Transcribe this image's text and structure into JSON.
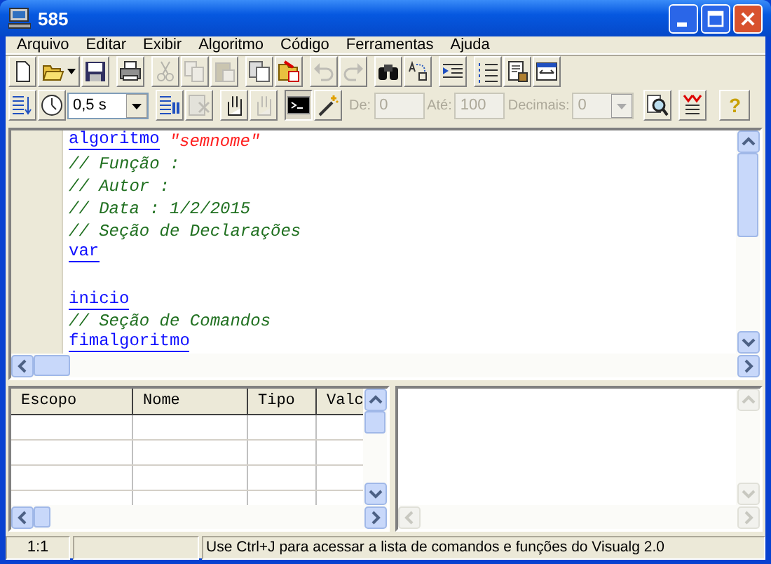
{
  "window": {
    "title": "585"
  },
  "menu": [
    "Arquivo",
    "Editar",
    "Exibir",
    "Algoritmo",
    "Código",
    "Ferramentas",
    "Ajuda"
  ],
  "toolbar_1": [
    {
      "buttons": [
        {
          "disabled": false
        },
        {
          "disabled": false
        },
        {
          "disabled": false
        }
      ]
    },
    {
      "buttons": [
        {
          "disabled": false
        }
      ]
    },
    {
      "buttons": [
        {
          "disabled": true
        },
        {
          "disabled": true
        },
        {
          "disabled": true
        }
      ]
    },
    {
      "buttons": [
        {
          "disabled": false
        },
        {
          "disabled": false
        }
      ]
    },
    {
      "buttons": [
        {
          "disabled": true
        },
        {
          "disabled": true
        }
      ]
    },
    {
      "buttons": [
        {
          "disabled": false
        },
        {
          "disabled": false
        }
      ]
    },
    {
      "buttons": [
        {
          "disabled": false
        }
      ]
    },
    {
      "buttons": [
        {
          "disabled": false
        },
        {
          "disabled": false
        },
        {
          "disabled": false
        }
      ]
    }
  ],
  "toolbar_2": [
    {
      "items": [
        {
          "kind": "button",
          "disabled": false,
          "pressed": false
        },
        {
          "kind": "button",
          "disabled": false,
          "pressed": false
        },
        {
          "kind": "select",
          "value": "0,5 s",
          "disabled": false
        }
      ]
    },
    {
      "items": [
        {
          "kind": "button",
          "disabled": false,
          "pressed": false
        },
        {
          "kind": "button",
          "disabled": true,
          "pressed": false
        }
      ]
    },
    {
      "items": [
        {
          "kind": "button",
          "disabled": false,
          "pressed": false
        },
        {
          "kind": "button",
          "disabled": true,
          "pressed": false
        }
      ]
    },
    {
      "items": [
        {
          "kind": "button",
          "disabled": false,
          "pressed": true
        },
        {
          "kind": "button",
          "disabled": false,
          "pressed": false
        }
      ]
    },
    {
      "items": [
        {
          "kind": "field",
          "label": "De:",
          "value": "0",
          "disabled": true
        },
        {
          "kind": "field",
          "label": "Até:",
          "value": "100",
          "disabled": true
        },
        {
          "kind": "select",
          "label": "Decimais:",
          "value": "0",
          "disabled": true
        }
      ]
    },
    {
      "items": [
        {
          "kind": "button",
          "disabled": false,
          "pressed": false
        }
      ]
    },
    {
      "items": [
        {
          "kind": "button",
          "disabled": false,
          "pressed": false
        }
      ]
    },
    {
      "items": [
        {
          "kind": "button",
          "label": "?",
          "disabled": false,
          "pressed": false
        }
      ]
    }
  ],
  "editor": {
    "lines": [
      {
        "blank_before": false,
        "segments": [
          {
            "text": "algoritmo",
            "kind": "keyword"
          },
          {
            "text": "\"semnome\"",
            "kind": "string"
          }
        ]
      },
      {
        "blank_before": false,
        "segments": [
          {
            "text": "// Função :",
            "kind": "comment"
          }
        ]
      },
      {
        "blank_before": false,
        "segments": [
          {
            "text": "// Autor :",
            "kind": "comment"
          }
        ]
      },
      {
        "blank_before": false,
        "segments": [
          {
            "text": "// Data : 1/2/2015",
            "kind": "comment"
          }
        ]
      },
      {
        "blank_before": false,
        "segments": [
          {
            "text": "// Seção de Declarações",
            "kind": "comment"
          }
        ]
      },
      {
        "blank_before": false,
        "segments": [
          {
            "text": "var",
            "kind": "keyword"
          }
        ]
      },
      {
        "blank_before": true,
        "segments": [
          {
            "text": "inicio",
            "kind": "keyword"
          }
        ]
      },
      {
        "blank_before": false,
        "segments": [
          {
            "text": "// Seção de Comandos",
            "kind": "comment"
          }
        ]
      },
      {
        "blank_before": false,
        "segments": [
          {
            "text": "fimalgoritmo",
            "kind": "keyword"
          }
        ]
      }
    ]
  },
  "variables_table": {
    "columns": [
      "Escopo",
      "Nome",
      "Tipo",
      "Valc"
    ]
  },
  "status_bar": {
    "position": "1:1",
    "message": "Use Ctrl+J para acessar a lista de comandos e funções do Visualg 2.0"
  }
}
